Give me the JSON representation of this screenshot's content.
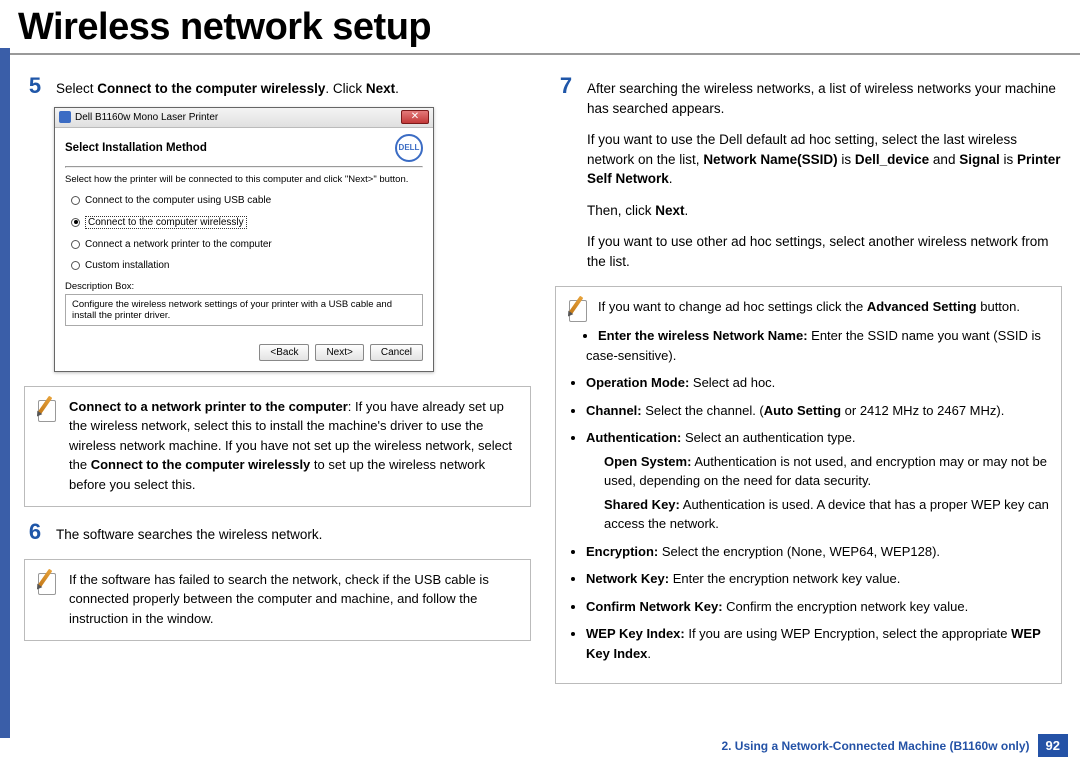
{
  "page": {
    "title": "Wireless network setup"
  },
  "left": {
    "step5": {
      "num": "5",
      "pre": "Select ",
      "bold1": "Connect to the computer wirelessly",
      "mid": ". Click ",
      "bold2": "Next",
      "post": "."
    },
    "dialog": {
      "window_title": "Dell B1160w Mono Laser Printer",
      "close": "✕",
      "heading": "Select Installation Method",
      "brand": "DELL",
      "instruction": "Select how the printer will be connected to this computer and click \"Next>\" button.",
      "radio1": "Connect to the computer using  USB cable",
      "radio2": "Connect to the computer wirelessly",
      "radio3": "Connect a network printer to the computer",
      "radio4": "Custom installation",
      "desc_label": "Description Box:",
      "desc_text": "Configure the wireless network settings of your printer with a USB cable and install the printer driver.",
      "btn_back": "<Back",
      "btn_next": "Next>",
      "btn_cancel": "Cancel"
    },
    "note5": {
      "bold1": "Connect to a network printer to the computer",
      "text1": ": If you have already set up the wireless network, select this to install the machine's driver to use the wireless network machine. If you have not set up the wireless network, select the ",
      "bold2": "Connect to the computer wirelessly",
      "text2": " to set up the wireless network before you select this."
    },
    "step6": {
      "num": "6",
      "text": "The software searches the wireless network."
    },
    "note6": {
      "text": "If the software has failed to search the network, check if the USB cable is connected properly between the computer and machine, and follow the instruction in the window."
    }
  },
  "right": {
    "step7": {
      "num": "7",
      "p1": "After searching the wireless networks, a list of wireless networks your machine has searched appears.",
      "p2a": "If you want to use the Dell default ad hoc setting, select the last wireless network on the list, ",
      "p2b1": "Network Name(SSID)",
      "p2c": " is ",
      "p2b2": "Dell_device",
      "p2d": " and ",
      "p2b3": "Signal",
      "p2e": " is ",
      "p2b4": "Printer Self Network",
      "p2f": ".",
      "p3a": "Then, click ",
      "p3b": "Next",
      "p3c": ".",
      "p4": "If you want to use other ad hoc settings, select another wireless network from the list."
    },
    "note7": {
      "intro_a": "If you want to change ad hoc settings click the ",
      "intro_b": "Advanced Setting",
      "intro_c": " button.",
      "bullets": [
        {
          "b": "Enter the wireless Network Name:",
          "t": " Enter the SSID name you want (SSID is case-sensitive)."
        },
        {
          "b": "Operation Mode:",
          "t": " Select ad hoc."
        },
        {
          "b": "Channel:",
          "t": " Select the channel. (",
          "b2": "Auto Setting",
          "t2": " or 2412 MHz to 2467 MHz)."
        },
        {
          "b": "Authentication:",
          "t": " Select an authentication type."
        }
      ],
      "auth_open_b": "Open System:",
      "auth_open_t": " Authentication is not used, and encryption may or may not be used, depending on the need for data security.",
      "auth_shared_b": "Shared Key:",
      "auth_shared_t": " Authentication is used. A device that has a proper WEP key can access the network.",
      "bullets2": [
        {
          "b": "Encryption:",
          "t": " Select the encryption (None, WEP64, WEP128)."
        },
        {
          "b": "Network Key:",
          "t": " Enter the encryption network key value."
        },
        {
          "b": "Confirm Network Key:",
          "t": " Confirm the encryption network key value."
        },
        {
          "b": "WEP Key Index:",
          "t": " If you are using WEP Encryption, select the appropriate ",
          "b2": "WEP Key Index",
          "t2": "."
        }
      ]
    }
  },
  "footer": {
    "chapter": "2.  Using a Network-Connected Machine (B1160w only)",
    "page": "92"
  }
}
